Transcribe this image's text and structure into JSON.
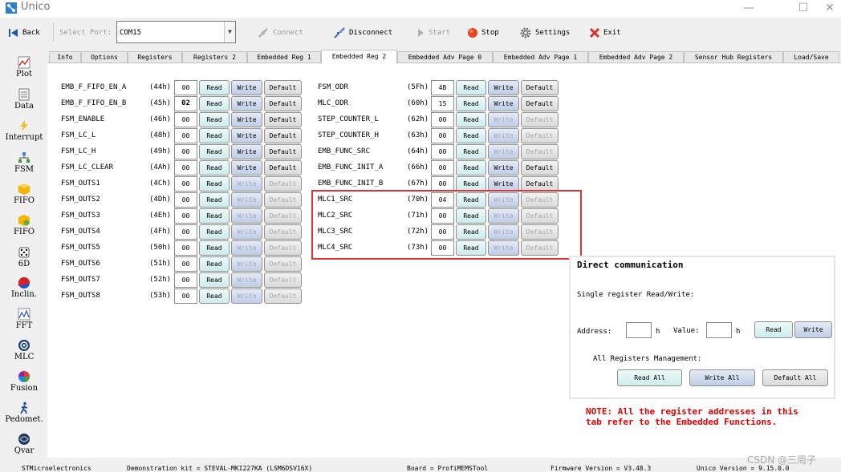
{
  "window": {
    "title": "Unico",
    "controls": {
      "minimize": "—",
      "maximize": "☐",
      "close": "✕"
    }
  },
  "toolbar": {
    "back": "Back",
    "select_port_label": "Select Port:",
    "port_value": "COM15",
    "connect": "Connect",
    "disconnect": "Disconnect",
    "start": "Start",
    "stop": "Stop",
    "settings": "Settings",
    "exit": "Exit"
  },
  "sidebar": [
    {
      "label": "Plot",
      "icon": "plot-icon"
    },
    {
      "label": "Data",
      "icon": "data-icon"
    },
    {
      "label": "Interrupt",
      "icon": "interrupt-icon"
    },
    {
      "label": "FSM",
      "icon": "fsm-icon"
    },
    {
      "label": "FIFO",
      "icon": "fifo-icon"
    },
    {
      "label": "FIFO",
      "icon": "fifo-config-icon"
    },
    {
      "label": "6D",
      "icon": "dice-icon"
    },
    {
      "label": "Inclin.",
      "icon": "inclination-icon"
    },
    {
      "label": "FFT",
      "icon": "fft-icon"
    },
    {
      "label": "MLC",
      "icon": "mlc-icon"
    },
    {
      "label": "Fusion",
      "icon": "fusion-icon"
    },
    {
      "label": "Pedomet.",
      "icon": "pedometer-icon"
    },
    {
      "label": "Qvar",
      "icon": "qvar-icon"
    }
  ],
  "tabs": [
    "Info",
    "Options",
    "Registers",
    "Registers 2",
    "Embedded Reg 1",
    "Embedded Reg 2",
    "Embedded Adv Page 0",
    "Embedded Adv Page 1",
    "Embedded Adv Page 2",
    "Sensor Hub Registers",
    "Load/Save"
  ],
  "buttons": {
    "read": "Read",
    "write": "Write",
    "default": "Default"
  },
  "registers_left": [
    {
      "name": "EMB_F_FIFO_EN_A",
      "addr": "(44h)",
      "value": "00",
      "writable": true
    },
    {
      "name": "EMB_F_FIFO_EN_B",
      "addr": "(45h)",
      "value": "02",
      "writable": true
    },
    {
      "name": "FSM_ENABLE",
      "addr": "(46h)",
      "value": "00",
      "writable": true
    },
    {
      "name": "FSM_LC_L",
      "addr": "(48h)",
      "value": "00",
      "writable": true
    },
    {
      "name": "FSM_LC_H",
      "addr": "(49h)",
      "value": "00",
      "writable": true
    },
    {
      "name": "FSM_LC_CLEAR",
      "addr": "(4Ah)",
      "value": "00",
      "writable": true
    },
    {
      "name": "FSM_OUTS1",
      "addr": "(4Ch)",
      "value": "00",
      "writable": false
    },
    {
      "name": "FSM_OUTS2",
      "addr": "(4Dh)",
      "value": "00",
      "writable": false
    },
    {
      "name": "FSM_OUTS3",
      "addr": "(4Eh)",
      "value": "00",
      "writable": false
    },
    {
      "name": "FSM_OUTS4",
      "addr": "(4Fh)",
      "value": "00",
      "writable": false
    },
    {
      "name": "FSM_OUTS5",
      "addr": "(50h)",
      "value": "00",
      "writable": false
    },
    {
      "name": "FSM_OUTS6",
      "addr": "(51h)",
      "value": "00",
      "writable": false
    },
    {
      "name": "FSM_OUTS7",
      "addr": "(52h)",
      "value": "00",
      "writable": false
    },
    {
      "name": "FSM_OUTS8",
      "addr": "(53h)",
      "value": "00",
      "writable": false
    }
  ],
  "registers_right": [
    {
      "name": "FSM_ODR",
      "addr": "(5Fh)",
      "value": "4B",
      "writable": true
    },
    {
      "name": "MLC_ODR",
      "addr": "(60h)",
      "value": "15",
      "writable": true
    },
    {
      "name": "STEP_COUNTER_L",
      "addr": "(62h)",
      "value": "00",
      "writable": false
    },
    {
      "name": "STEP_COUNTER_H",
      "addr": "(63h)",
      "value": "00",
      "writable": false
    },
    {
      "name": "EMB_FUNC_SRC",
      "addr": "(64h)",
      "value": "00",
      "writable": false
    },
    {
      "name": "EMB_FUNC_INIT_A",
      "addr": "(66h)",
      "value": "00",
      "writable": true
    },
    {
      "name": "EMB_FUNC_INIT_B",
      "addr": "(67h)",
      "value": "00",
      "writable": true
    },
    {
      "name": "MLC1_SRC",
      "addr": "(70h)",
      "value": "04",
      "writable": false
    },
    {
      "name": "MLC2_SRC",
      "addr": "(71h)",
      "value": "00",
      "writable": false
    },
    {
      "name": "MLC3_SRC",
      "addr": "(72h)",
      "value": "00",
      "writable": false
    },
    {
      "name": "MLC4_SRC",
      "addr": "(73h)",
      "value": "00",
      "writable": false
    }
  ],
  "direct": {
    "title": "Direct communication",
    "single_label": "Single register Read/Write:",
    "address_label": "Address:",
    "h1": "h",
    "value_label": "Value:",
    "h2": "h",
    "read": "Read",
    "write": "Write",
    "all_label": "All Registers Management:",
    "read_all": "Read All",
    "write_all": "Write All",
    "default_all": "Default All"
  },
  "note": {
    "line1": "NOTE: All the register addresses in this",
    "line2": "tab refer to the Embedded Functions."
  },
  "status": {
    "company": "STMicroelectronics",
    "kit": "Demonstration kit = STEVAL-MKI227KA (LSM6DSV16X)",
    "board": "Board = ProfiMEMSTool",
    "firmware": "Firmware Version = V3.48.3",
    "unico_version": "Unico Version = 9.15.0.0"
  },
  "watermark": "CSDN @三周子"
}
